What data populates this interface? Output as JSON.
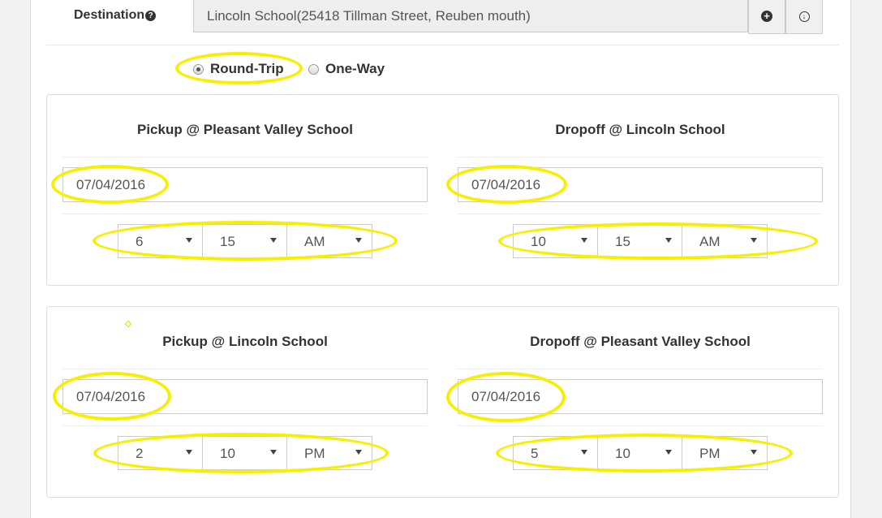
{
  "destination": {
    "label": "Destination",
    "help_icon": "question-circle-icon",
    "value": "Lincoln School(25418 Tillman Street, Reuben mouth)",
    "add_icon": "plus-circle-icon",
    "download_icon": "arrow-down-circle-icon"
  },
  "trip_type": {
    "options": [
      {
        "label": "Round-Trip",
        "checked": true
      },
      {
        "label": "One-Way",
        "checked": false
      }
    ]
  },
  "outbound": {
    "pickup": {
      "title": "Pickup @ Pleasant Valley School",
      "date": "07/04/2016",
      "hour": "6",
      "minute": "15",
      "ampm": "AM"
    },
    "dropoff": {
      "title": "Dropoff @ Lincoln School",
      "date": "07/04/2016",
      "hour": "10",
      "minute": "15",
      "ampm": "AM"
    }
  },
  "return": {
    "pickup": {
      "title": "Pickup @ Lincoln School",
      "date": "07/04/2016",
      "hour": "2",
      "minute": "10",
      "ampm": "PM"
    },
    "dropoff": {
      "title": "Dropoff @ Pleasant Valley School",
      "date": "07/04/2016",
      "hour": "5",
      "minute": "10",
      "ampm": "PM"
    }
  },
  "colors": {
    "highlight": "#f6f000",
    "panel_border": "#dddddd",
    "text": "#333333"
  }
}
